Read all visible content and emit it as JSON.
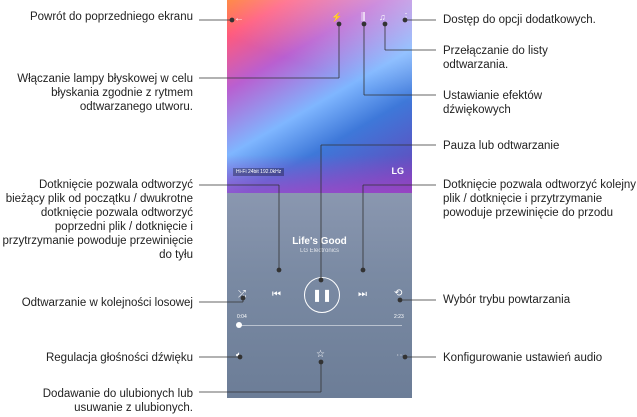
{
  "player": {
    "song_title": "Life's Good",
    "artist": "LG Electronics",
    "hifi_badge": "Hi-Fi  24bit 192.0kHz",
    "brand": "LG",
    "time_elapsed": "0:04",
    "time_total": "2:23",
    "progress_fraction": 0.03
  },
  "callouts": {
    "back": "Powrót do poprzedniego ekranu",
    "flash": "Włączanie lampy błyskowej w celu błyskania zgodnie z rytmem odtwarzanego utworu.",
    "prev": "Dotknięcie pozwala odtworzyć bieżący plik od początku / dwukrotne dotknięcie pozwala odtworzyć poprzedni plik / dotknięcie i przytrzymanie powoduje przewinięcie do tyłu",
    "shuffle": "Odtwarzanie w kolejności losowej",
    "volume": "Regulacja głośności dźwięku",
    "favorite": "Dodawanie do ulubionych lub usuwanie z ulubionych.",
    "more": "Dostęp do opcji dodatkowych.",
    "playlist": "Przełączanie do listy odtwarzania.",
    "effects": "Ustawianie efektów dźwiękowych",
    "pause": "Pauza lub odtwarzanie",
    "next": "Dotknięcie pozwala odtworzyć kolejny plik / dotknięcie i przytrzymanie powoduje przewinięcie do przodu",
    "repeat": "Wybór trybu powtarzania",
    "audio": "Konfigurowanie ustawień audio"
  }
}
